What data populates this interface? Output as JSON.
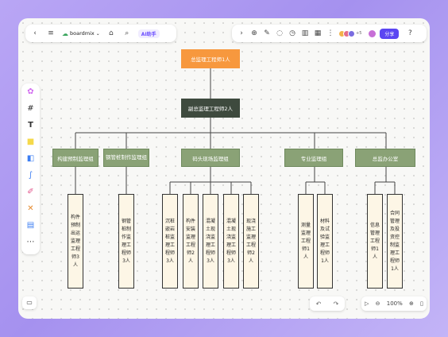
{
  "toolbar": {
    "app_name": "boardmix",
    "ai_label": "AI助手",
    "share_label": "分享",
    "avatars_extra": "+5"
  },
  "zoom": "100%",
  "chart": {
    "top": "总监理工程师1人",
    "second": "副总监理工程师2人",
    "groups": [
      {
        "label": "构建预制监理组",
        "children": [
          "构件预制出运监理工程师3人"
        ]
      },
      {
        "label": "钢管桩制作监理组",
        "children": [
          "钢管桩制作监理工程师3人"
        ]
      },
      {
        "label": "码头现场监理组",
        "children": [
          "沉桩嵌岩桩监理工程师3人",
          "构件安装监理工程师2人",
          "混凝土现浇监理工程师3人",
          "混凝土现浇监理工程师3人",
          "现浇施工监理工程师2人"
        ]
      },
      {
        "label": "专业监理组",
        "children": [
          "测量监理工程师1人",
          "材料及试验监理工程师1人"
        ]
      },
      {
        "label": "总监办公室",
        "children": [
          "信息管理工程师1人",
          "合同管理及投资控制监理工程师1人"
        ]
      }
    ]
  },
  "colors": {
    "top": "#f7983e",
    "second": "#3e4a3e",
    "group": "#8aa276",
    "leaf": "#fdf6e6",
    "accent": "#5b46f2"
  }
}
